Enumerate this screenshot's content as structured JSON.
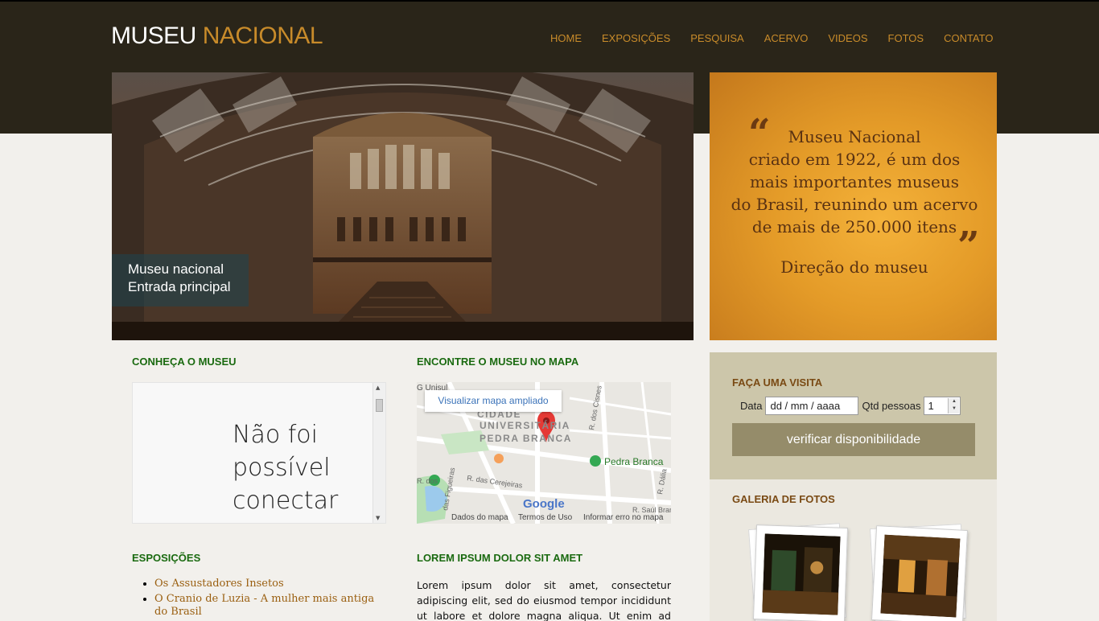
{
  "header": {
    "logo_part1": "MUSEU",
    "logo_part2": "NACIONAL",
    "nav": [
      "HOME",
      "EXPOSIÇÕES",
      "PESQUISA",
      "ACERVO",
      "VIDEOS",
      "FOTOS",
      "CONTATO"
    ]
  },
  "hero": {
    "caption_line1": "Museu nacional",
    "caption_line2": "Entrada principal"
  },
  "quote": {
    "open_mark": "“",
    "close_mark": "”",
    "lines": [
      "Museu Nacional",
      "criado em 1922, é um dos",
      "mais importantes museus",
      "do Brasil, reunindo um acervo",
      "de mais de 250.000 itens"
    ],
    "author": "Direção do museu"
  },
  "visit": {
    "title": "FAÇA UMA VISITA",
    "date_label": "Data",
    "date_placeholder": "dd / mm / aaaa",
    "qty_label": "Qtd pessoas",
    "qty_value": "1",
    "button_label": "verificar disponibilidade"
  },
  "gallery": {
    "title": "GALERIA DE FOTOS"
  },
  "about": {
    "title": "CONHEÇA O MUSEU",
    "error_lines": [
      "Não foi",
      "possível",
      "conectar"
    ]
  },
  "map": {
    "title": "ENCONTRE O MUSEU NO MAPA",
    "expand_label": "Visualizar mapa ampliado",
    "labels": {
      "area_line1": "CIDADE",
      "area_line2": "UNIVERSITÁRIA",
      "area_line3": "PEDRA BRANCA",
      "place": "Pedra Branca",
      "street1": "R. das Cerejeiras",
      "street2": "das Figueiras",
      "street3": "R. dos Cisnes",
      "street4": "R. Saúl Bran",
      "street5": "R. Dália",
      "street6": "R. dos",
      "unisul": "G Unisul",
      "brand": "Google"
    },
    "footer": [
      "Dados do mapa",
      "Termos de Uso",
      "Informar erro no mapa"
    ]
  },
  "exhibitions": {
    "title": "ESPOSIÇÕES",
    "items": [
      "Os Assustadores Insetos",
      "O Cranio de Luzia - A mulher mais antiga do Brasil"
    ]
  },
  "lorem": {
    "title": "LOREM IPSUM DOLOR SIT AMET",
    "text": "Lorem ipsum dolor sit amet, consectetur adipiscing elit, sed do eiusmod tempor incididunt ut labore et dolore magna aliqua. Ut enim ad minim veniam, quis"
  },
  "colors": {
    "header_bg": "#2a2519",
    "accent": "#c88b2a",
    "heading_green": "#1a6a10",
    "heading_brown": "#7a4a14",
    "button_bg": "#958c6a",
    "visit_bg": "#ccc6aa"
  }
}
